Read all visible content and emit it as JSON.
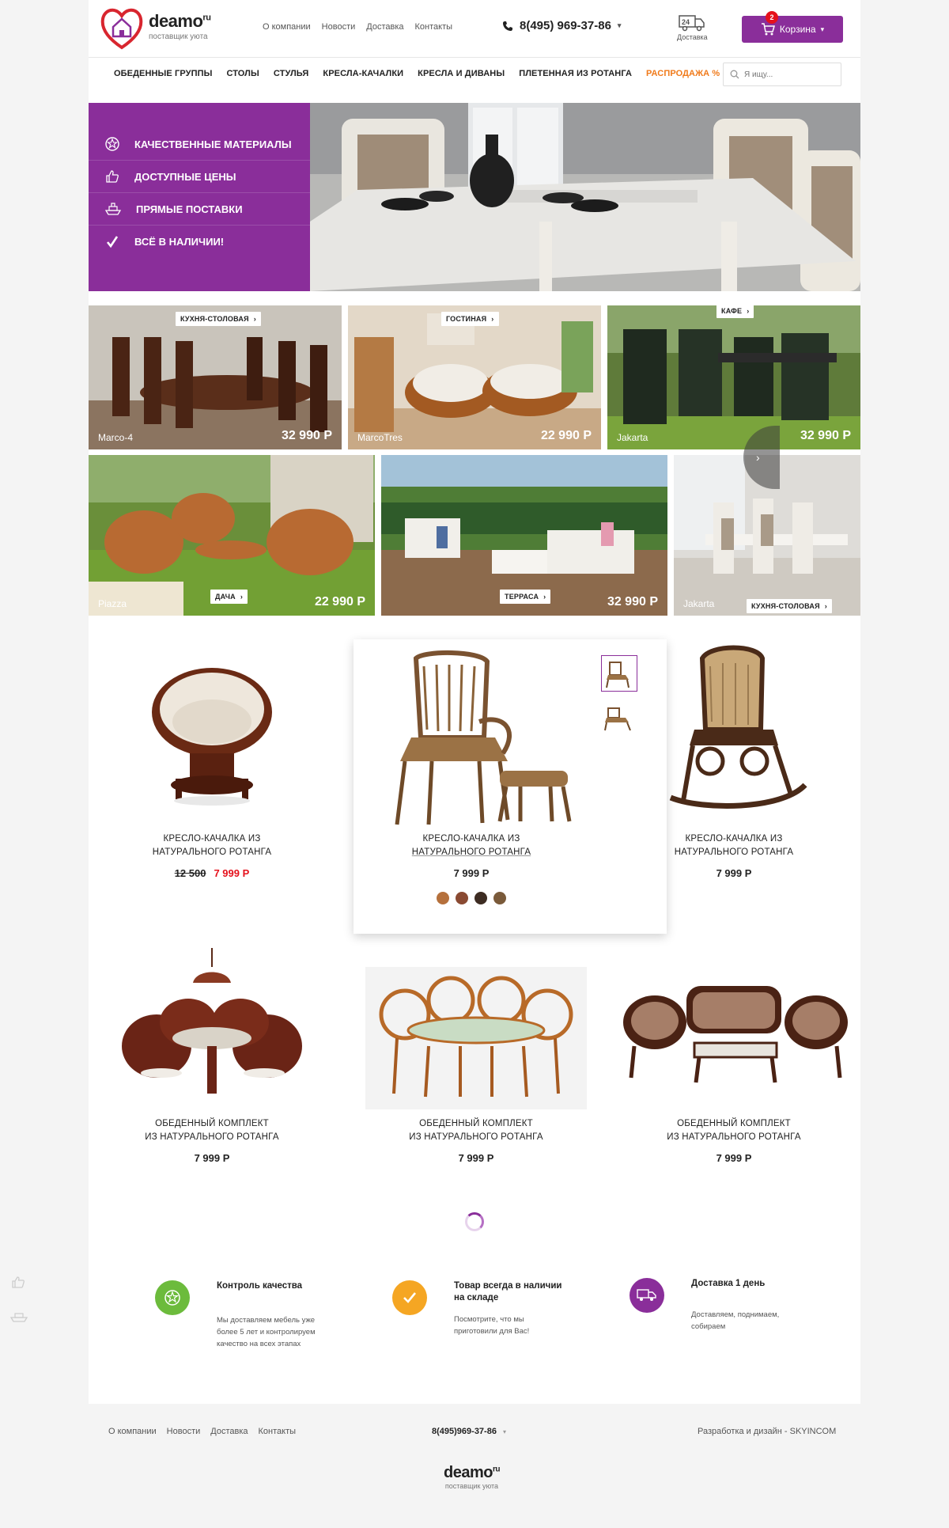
{
  "header": {
    "logo_name": "deamo",
    "logo_tld": "ru",
    "logo_sub": "поставщик уюта",
    "topnav": [
      "О компании",
      "Новости",
      "Доставка",
      "Контакты"
    ],
    "phone": "8(495) 969-37-86",
    "delivery_badge": "24",
    "delivery_label": "Доставка",
    "cart_label": "Корзина",
    "cart_count": "2"
  },
  "mainnav": {
    "items": [
      "ОБЕДЕННЫЕ ГРУППЫ",
      "СТОЛЫ",
      "СТУЛЬЯ",
      "КРЕСЛА-КАЧАЛКИ",
      "КРЕСЛА И ДИВАНЫ",
      "ПЛЕТЕННАЯ ИЗ РОТАНГА"
    ],
    "sale": "РАСПРОДАЖА %",
    "search_placeholder": "Я ищу..."
  },
  "hero": {
    "items": [
      "КАЧЕСТВЕННЫЕ МАТЕРИАЛЫ",
      "ДОСТУПНЫЕ ЦЕНЫ",
      "ПРЯМЫЕ ПОСТАВКИ",
      "ВСЁ В НАЛИЧИИ!"
    ]
  },
  "tiles": [
    {
      "tag": "КУХНЯ-СТОЛОВАЯ",
      "name": "Marco-4",
      "price": "32 990 Р"
    },
    {
      "tag": "ГОСТИНАЯ",
      "name": "MarcoTres",
      "price": "22 990 Р"
    },
    {
      "tag": "КАФЕ",
      "name": "Jakarta",
      "price": "32 990 Р"
    },
    {
      "tag": "ДАЧА",
      "name": "Piazza",
      "price": "22 990 Р"
    },
    {
      "tag": "ТЕРРАСА",
      "name": "",
      "price": "32 990 Р"
    },
    {
      "tag": "КУХНЯ-СТОЛОВАЯ",
      "name": "Jakarta",
      "price": ""
    }
  ],
  "products": [
    {
      "title1": "КРЕСЛО-КАЧАЛКА ИЗ",
      "title2": "НАТУРАЛЬНОГО РОТАНГА",
      "old_price": "12 500",
      "price": "7 999 Р"
    },
    {
      "title1": "КРЕСЛО-КАЧАЛКА ИЗ",
      "title2": "НАТУРАЛЬНОГО РОТАНГА",
      "price": "7 999 Р"
    },
    {
      "title1": "КРЕСЛО-КАЧАЛКА ИЗ",
      "title2": "НАТУРАЛЬНОГО РОТАНГА",
      "price": "7 999 Р"
    },
    {
      "title1": "ОБЕДЕННЫЙ КОМПЛЕКТ",
      "title2": "ИЗ НАТУРАЛЬНОГО РОТАНГА",
      "price": "7 999 Р"
    },
    {
      "title1": "ОБЕДЕННЫЙ КОМПЛЕКТ",
      "title2": "ИЗ НАТУРАЛЬНОГО РОТАНГА",
      "price": "7 999 Р"
    },
    {
      "title1": "ОБЕДЕННЫЙ КОМПЛЕКТ",
      "title2": "ИЗ НАТУРАЛЬНОГО РОТАНГА",
      "price": "7 999 Р"
    }
  ],
  "swatch_colors": [
    "#b5703c",
    "#8a4a32",
    "#3d2c22",
    "#7a5a3a"
  ],
  "features": [
    {
      "title": "Контроль качества",
      "desc": "Мы доставляем мебель уже более 5 лет и контролируем качество на всех этапах",
      "color": "#6cbb3c"
    },
    {
      "title": "Товар всегда в наличии на складе",
      "desc": "Посмотрите, что мы приготовили для Вас!",
      "color": "#f5a623"
    },
    {
      "title": "Доставка 1 день",
      "desc": "Доставляем, поднимаем, собираем",
      "color": "#8a2e9a"
    }
  ],
  "footer": {
    "nav": [
      "О компании",
      "Новости",
      "Доставка",
      "Контакты"
    ],
    "phone": "8(495)969-37-86",
    "dev": "Разработка и дизайн - SKYINCOM",
    "logo_name": "deamo",
    "logo_tld": "ru",
    "logo_sub": "поставщик уюта"
  },
  "colors": {
    "brand": "#8a2e9a",
    "sale": "#f07a1a",
    "price_red": "#e5111c"
  }
}
